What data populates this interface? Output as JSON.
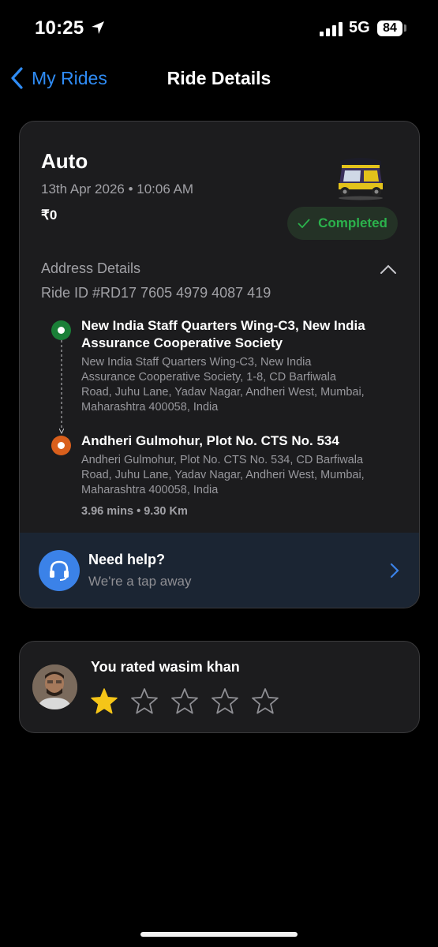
{
  "status_bar": {
    "time": "10:25",
    "network": "5G",
    "battery": "84"
  },
  "nav": {
    "back_label": "My Rides",
    "title": "Ride Details"
  },
  "ride": {
    "type": "Auto",
    "datetime": "13th Apr 2026 • 10:06 AM",
    "fare": "₹0",
    "status": "Completed"
  },
  "address": {
    "heading": "Address Details",
    "ride_id": "Ride ID #RD17 7605 4979 4087 419",
    "pickup_title": "New India Staff Quarters Wing-C3, New India Assurance Cooperative Society",
    "pickup_address": "New India Staff Quarters Wing-C3, New India Assurance Cooperative Society, 1-8, CD Barfiwala Road, Juhu Lane, Yadav Nagar, Andheri West, Mumbai, Maharashtra 400058, India",
    "drop_title": "Andheri Gulmohur, Plot No. CTS No. 534",
    "drop_address": "Andheri Gulmohur, Plot No. CTS No. 534, CD Barfiwala Road, Juhu Lane, Yadav Nagar, Andheri West, Mumbai, Maharashtra 400058, India",
    "trip_meta": "3.96 mins • 9.30 Km"
  },
  "help": {
    "title": "Need help?",
    "subtitle": "We're a tap away"
  },
  "rating": {
    "label": "You rated wasim khan",
    "stars_filled": 1,
    "stars_total": 5
  },
  "colors": {
    "accent": "#2f8cf5",
    "completed": "#2bb24c",
    "pickup_pin": "#1a7f37",
    "drop_pin": "#d95f1c",
    "star_filled": "#f5c518"
  }
}
